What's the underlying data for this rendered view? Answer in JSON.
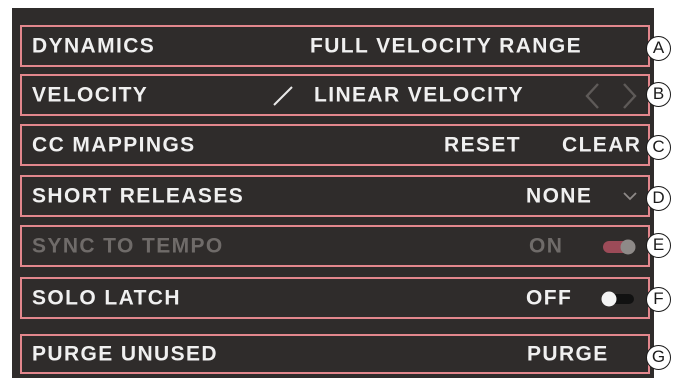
{
  "rows": {
    "dynamics": {
      "label": "DYNAMICS",
      "value": "FULL VELOCITY RANGE",
      "marker": "A"
    },
    "velocity": {
      "label": "VELOCITY",
      "value": "LINEAR VELOCITY",
      "marker": "B"
    },
    "cc_mappings": {
      "label": "CC MAPPINGS",
      "reset_label": "RESET",
      "clear_label": "CLEAR",
      "marker": "C"
    },
    "short_releases": {
      "label": "SHORT RELEASES",
      "value": "NONE",
      "marker": "D"
    },
    "sync_to_tempo": {
      "label": "SYNC TO TEMPO",
      "value": "ON",
      "marker": "E",
      "enabled": false,
      "toggle_on": true
    },
    "solo_latch": {
      "label": "SOLO LATCH",
      "value": "OFF",
      "marker": "F",
      "toggle_on": false
    },
    "purge_unused": {
      "label": "PURGE UNUSED",
      "button_label": "PURGE",
      "marker": "G"
    }
  },
  "icons": {
    "velocity_curve": "linear-curve-icon",
    "prev": "chevron-left-icon",
    "next": "chevron-right-icon",
    "dropdown": "chevron-down-icon",
    "sync_toggle": "toggle-switch-icon",
    "solo_toggle": "toggle-switch-icon"
  },
  "colors": {
    "panel": "#2f2c2b",
    "text": "#f0f0f0",
    "disabled_text": "#6f6b69",
    "outline": "#e3878d",
    "toggle_on_track": "#9c4b58"
  }
}
